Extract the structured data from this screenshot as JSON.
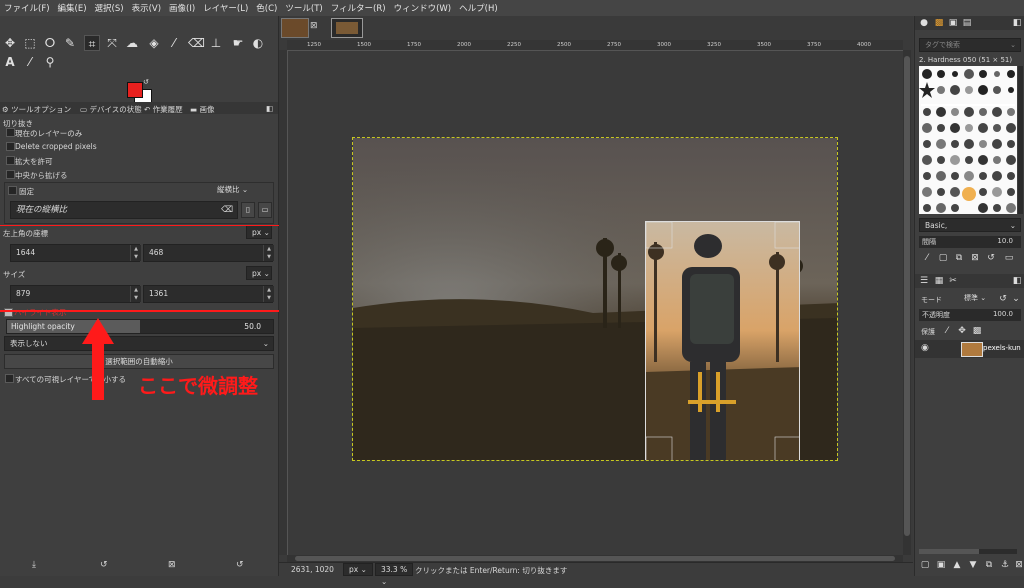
{
  "menubar": {
    "items": [
      "ファイル(F)",
      "編集(E)",
      "選択(S)",
      "表示(V)",
      "画像(I)",
      "レイヤー(L)",
      "色(C)",
      "ツール(T)",
      "フィルター(R)",
      "ウィンドウ(W)",
      "ヘルプ(H)"
    ]
  },
  "tabs": {
    "tool_options": "ツールオプション",
    "device_status": "デバイスの状態",
    "undo_history": "作業履歴",
    "images": "画像"
  },
  "tool_options": {
    "title": "切り抜き",
    "current_layer_only": "現在のレイヤーのみ",
    "delete_cropped": "Delete cropped pixels",
    "allow_growing": "拡大を許可",
    "expand_from_center": "中央から拡げる",
    "fixed_label": "固定",
    "fixed_value": "縦横比",
    "aspect_current": "現在の縦横比",
    "position_label": "左上角の座標",
    "position_unit": "px",
    "pos_x": "1644",
    "pos_y": "468",
    "size_label": "サイズ",
    "size_unit": "px",
    "size_w": "879",
    "size_h": "1361",
    "highlight_label": "ハイライト表示",
    "highlight_opacity_label": "Highlight opacity",
    "highlight_opacity_value": "50.0",
    "guides_value": "表示しない",
    "auto_shrink": "選択範囲の自動縮小",
    "shrink_merged": "すべての可視レイヤーで縮小する",
    "opacity_fill_fraction": 0.5
  },
  "annotation": {
    "text": "ここで微調整",
    "color": "#ff1a1a"
  },
  "ruler": {
    "ticks": [
      "1250",
      "1500",
      "1750",
      "2000",
      "2250",
      "2500",
      "2750",
      "3000",
      "3250",
      "3500",
      "3750",
      "4000"
    ]
  },
  "statusbar": {
    "coords": "2631, 1020",
    "unit": "px",
    "zoom": "33.3 %",
    "message": "クリックまたは Enter/Return: 切り抜きます"
  },
  "brushes": {
    "filter_placeholder": "タグで検索",
    "current_brush": "2. Hardness 050 (51 × 51)",
    "preset": "Basic,",
    "spacing_label": "間隔",
    "spacing_value": "10.0"
  },
  "layers": {
    "mode_label": "モード",
    "mode_value": "標準",
    "opacity_label": "不透明度",
    "opacity_value": "100.0",
    "lock_label": "保護",
    "layer_name": "pexels-kun"
  },
  "colors": {
    "foreground": "#e8201e",
    "background": "#ffffff",
    "accent_red": "#ff1a1a"
  }
}
